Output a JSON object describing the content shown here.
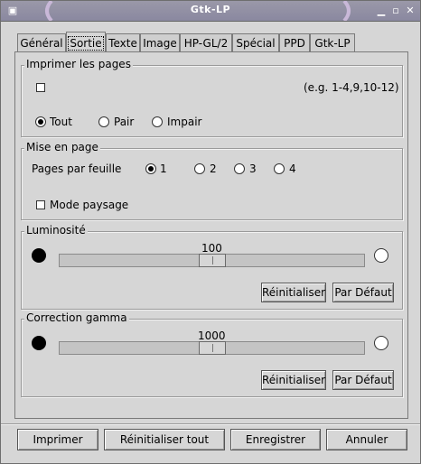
{
  "window": {
    "title": "Gtk-LP"
  },
  "tabs": [
    "Général",
    "Sortie",
    "Texte",
    "Image",
    "HP-GL/2",
    "Spécial",
    "PPD",
    "Gtk-LP"
  ],
  "print_pages": {
    "label": "Imprimer les pages",
    "range_checked": false,
    "range_hint": "(e.g. 1-4,9,10-12)",
    "options": [
      "Tout",
      "Pair",
      "Impair"
    ],
    "selected": "Tout"
  },
  "layout": {
    "label": "Mise en page",
    "pages_per_sheet_label": "Pages par feuille",
    "pages_options": [
      "1",
      "2",
      "3",
      "4"
    ],
    "selected": "1",
    "landscape_label": "Mode paysage",
    "landscape_checked": false
  },
  "brightness": {
    "label": "Luminosité",
    "value": "100",
    "reset_label": "Réinitialiser",
    "default_label": "Par Défaut"
  },
  "gamma": {
    "label": "Correction gamma",
    "value": "1000",
    "reset_label": "Réinitialiser",
    "default_label": "Par Défaut"
  },
  "footer": {
    "print": "Imprimer",
    "reset_all": "Réinitialiser tout",
    "save": "Enregistrer",
    "cancel": "Annuler"
  }
}
